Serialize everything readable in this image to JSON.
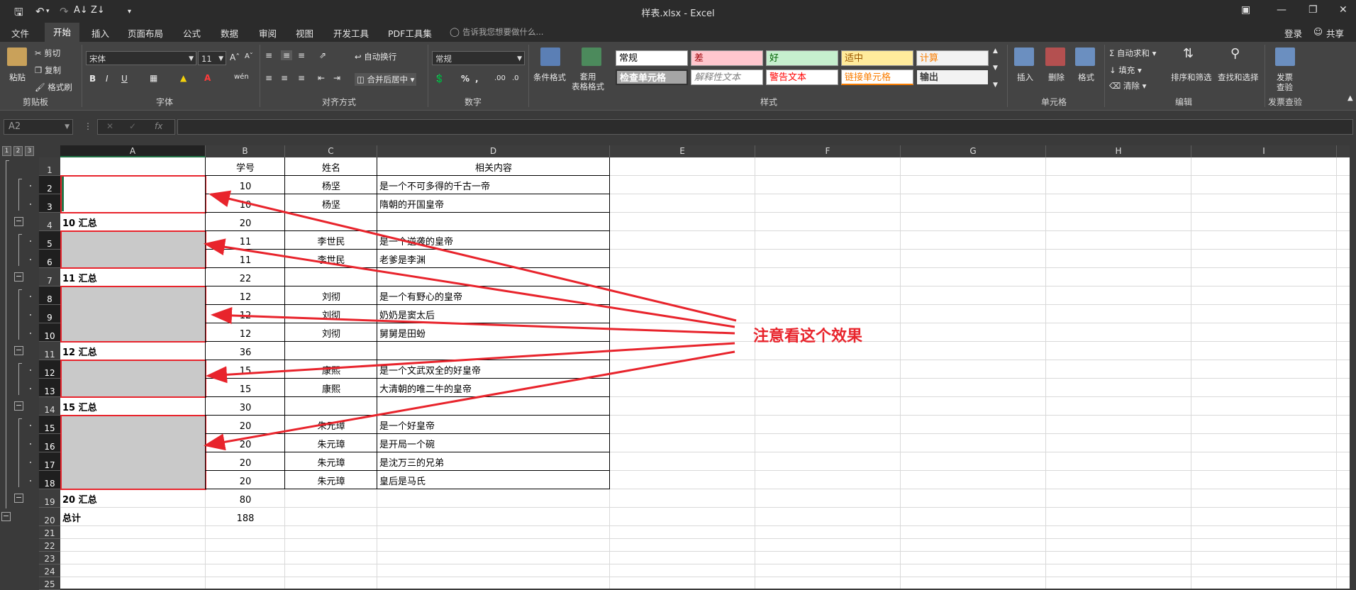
{
  "window": {
    "title": "样表.xlsx - Excel"
  },
  "menu": {
    "tabs": [
      "文件",
      "开始",
      "插入",
      "页面布局",
      "公式",
      "数据",
      "审阅",
      "视图",
      "开发工具",
      "PDF工具集"
    ],
    "active_tab": "开始",
    "tell_me": "告诉我您想要做什么...",
    "login": "登录",
    "share": "共享"
  },
  "ribbon": {
    "clipboard": {
      "paste": "粘贴",
      "cut": "剪切",
      "copy": "复制",
      "format_painter": "格式刷",
      "label": "剪贴板"
    },
    "font": {
      "name": "宋体",
      "size": "11",
      "label": "字体",
      "bold": "B",
      "italic": "I",
      "underline": "U"
    },
    "alignment": {
      "wrap": "自动换行",
      "merge": "合并后居中",
      "label": "对齐方式"
    },
    "number": {
      "format": "常规",
      "label": "数字",
      "percent": "%",
      "comma": ","
    },
    "styles": {
      "conditional": "条件格式",
      "table": "套用\n表格格式",
      "cells": [
        {
          "text": "常规",
          "bg": "#ffffff",
          "fg": "#000000"
        },
        {
          "text": "差",
          "bg": "#ffc7ce",
          "fg": "#9c0006"
        },
        {
          "text": "好",
          "bg": "#c6efce",
          "fg": "#006100"
        },
        {
          "text": "适中",
          "bg": "#ffeb9c",
          "fg": "#9c5700"
        },
        {
          "text": "计算",
          "bg": "#f2f2f2",
          "fg": "#fa7d00"
        },
        {
          "text": "检查单元格",
          "bg": "#a5a5a5",
          "fg": "#ffffff"
        },
        {
          "text": "解释性文本",
          "bg": "#ffffff",
          "fg": "#7f7f7f"
        },
        {
          "text": "警告文本",
          "bg": "#ffffff",
          "fg": "#ff0000"
        },
        {
          "text": "链接单元格",
          "bg": "#ffffff",
          "fg": "#fa7d00"
        },
        {
          "text": "输出",
          "bg": "#f2f2f2",
          "fg": "#3f3f3f"
        }
      ],
      "label": "样式"
    },
    "cells_group": {
      "insert": "插入",
      "delete": "删除",
      "format": "格式",
      "label": "单元格"
    },
    "editing": {
      "autosum": "自动求和",
      "fill": "填充",
      "clear": "清除",
      "sort": "排序和筛选",
      "find": "查找和选择",
      "label": "编辑"
    },
    "invoice": {
      "label1": "发票",
      "label2": "查验",
      "group": "发票查验"
    }
  },
  "formula_bar": {
    "name_box": "A2",
    "fx": "fx",
    "formula": ""
  },
  "outline_levels": [
    "1",
    "2",
    "3"
  ],
  "columns": [
    "A",
    "B",
    "C",
    "D",
    "E",
    "F",
    "G",
    "H",
    "I"
  ],
  "rows": [
    {
      "n": "1",
      "a": "",
      "b": "学号",
      "c": "姓名",
      "d": "相关内容"
    },
    {
      "n": "2",
      "a": "",
      "b": "10",
      "c": "杨坚",
      "d": "是一个不可多得的千古一帝"
    },
    {
      "n": "3",
      "a": "",
      "b": "10",
      "c": "杨坚",
      "d": "隋朝的开国皇帝"
    },
    {
      "n": "4",
      "a": "10 汇总",
      "b": "20",
      "c": "",
      "d": ""
    },
    {
      "n": "5",
      "a": "",
      "b": "11",
      "c": "李世民",
      "d": "是一个逆袭的皇帝"
    },
    {
      "n": "6",
      "a": "",
      "b": "11",
      "c": "李世民",
      "d": "老爹是李渊"
    },
    {
      "n": "7",
      "a": "11 汇总",
      "b": "22",
      "c": "",
      "d": ""
    },
    {
      "n": "8",
      "a": "",
      "b": "12",
      "c": "刘彻",
      "d": "是一个有野心的皇帝"
    },
    {
      "n": "9",
      "a": "",
      "b": "12",
      "c": "刘彻",
      "d": "奶奶是窦太后"
    },
    {
      "n": "10",
      "a": "",
      "b": "12",
      "c": "刘彻",
      "d": "舅舅是田蚡"
    },
    {
      "n": "11",
      "a": "12 汇总",
      "b": "36",
      "c": "",
      "d": ""
    },
    {
      "n": "12",
      "a": "",
      "b": "15",
      "c": "康熙",
      "d": "是一个文武双全的好皇帝"
    },
    {
      "n": "13",
      "a": "",
      "b": "15",
      "c": "康熙",
      "d": "大清朝的唯二牛的皇帝"
    },
    {
      "n": "14",
      "a": "15 汇总",
      "b": "30",
      "c": "",
      "d": ""
    },
    {
      "n": "15",
      "a": "",
      "b": "20",
      "c": "朱元璋",
      "d": "是一个好皇帝"
    },
    {
      "n": "16",
      "a": "",
      "b": "20",
      "c": "朱元璋",
      "d": "是开局一个碗"
    },
    {
      "n": "17",
      "a": "",
      "b": "20",
      "c": "朱元璋",
      "d": "是沈万三的兄弟"
    },
    {
      "n": "18",
      "a": "",
      "b": "20",
      "c": "朱元璋",
      "d": "皇后是马氏"
    },
    {
      "n": "19",
      "a": "20 汇总",
      "b": "80",
      "c": "",
      "d": ""
    },
    {
      "n": "20",
      "a": "总计",
      "b": "188",
      "c": "",
      "d": ""
    },
    {
      "n": "21",
      "a": "",
      "b": "",
      "c": "",
      "d": ""
    },
    {
      "n": "22",
      "a": "",
      "b": "",
      "c": "",
      "d": ""
    },
    {
      "n": "23",
      "a": "",
      "b": "",
      "c": "",
      "d": ""
    },
    {
      "n": "24",
      "a": "",
      "b": "",
      "c": "",
      "d": ""
    },
    {
      "n": "25",
      "a": "",
      "b": "",
      "c": "",
      "d": ""
    }
  ],
  "annotation": {
    "text": "注意看这个效果",
    "color": "#e8242c"
  }
}
